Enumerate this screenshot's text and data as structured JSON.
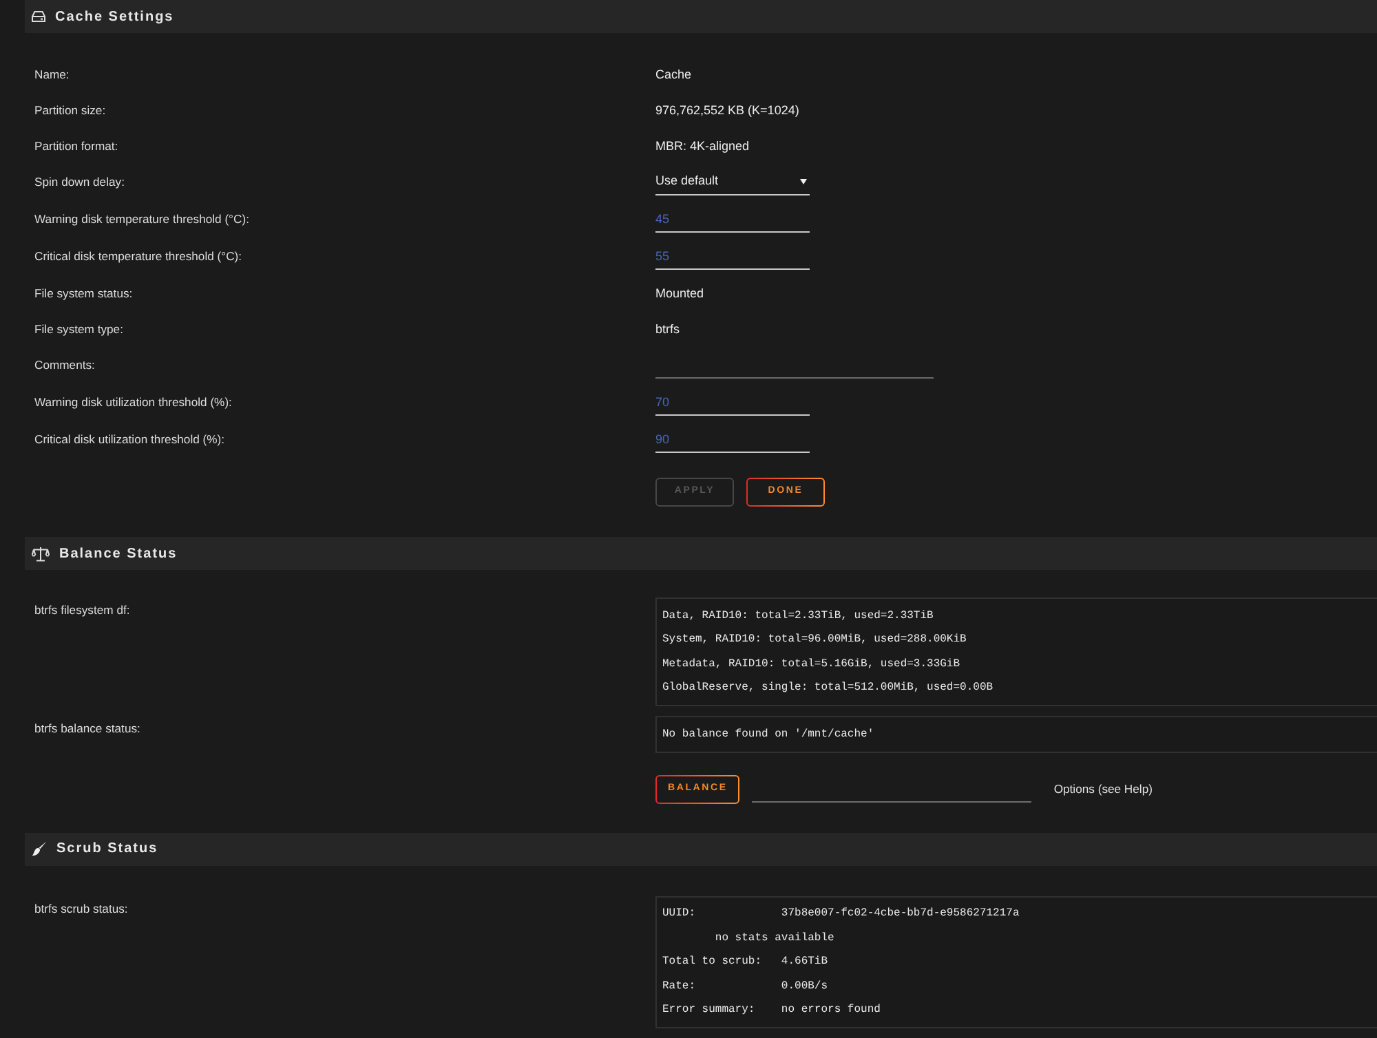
{
  "sections": [
    {
      "title": "Cache Settings",
      "fields": [
        {
          "label": "Name:",
          "kind": "text",
          "value": "Cache"
        },
        {
          "label": "Partition size:",
          "kind": "text",
          "value": "976,762,552 KB (K=1024)"
        },
        {
          "label": "Partition format:",
          "kind": "text",
          "value": "MBR: 4K-aligned"
        },
        {
          "label": "Spin down delay:",
          "kind": "select",
          "value": "Use default"
        },
        {
          "label": "Warning disk temperature threshold (°C):",
          "kind": "number",
          "value": "45"
        },
        {
          "label": "Critical disk temperature threshold (°C):",
          "kind": "number",
          "value": "55"
        },
        {
          "label": "File system status:",
          "kind": "text",
          "value": "Mounted"
        },
        {
          "label": "File system type:",
          "kind": "text",
          "value": "btrfs"
        },
        {
          "label": "Comments:",
          "kind": "textline"
        },
        {
          "label": "Warning disk utilization threshold (%):",
          "kind": "number",
          "value": "70"
        },
        {
          "label": "Critical disk utilization threshold (%):",
          "kind": "number",
          "value": "90"
        }
      ],
      "actions": [
        {
          "kind": "button",
          "label": "APPLY",
          "disabled": true
        },
        {
          "kind": "button",
          "label": "DONE",
          "disabled": false
        }
      ]
    },
    {
      "title": "Balance Status",
      "fields": [
        {
          "label": "btrfs filesystem df:",
          "kind": "output",
          "lines": [
            "Data, RAID10: total=2.33TiB, used=2.33TiB",
            "System, RAID10: total=96.00MiB, used=288.00KiB",
            "Metadata, RAID10: total=5.16GiB, used=3.33GiB",
            "GlobalReserve, single: total=512.00MiB, used=0.00B"
          ]
        },
        {
          "label": "btrfs balance status:",
          "kind": "output",
          "lines": [
            "No balance found on '/mnt/cache'"
          ]
        }
      ],
      "actions": [
        {
          "kind": "button",
          "label": "BALANCE",
          "disabled": false
        },
        {
          "kind": "field"
        },
        {
          "kind": "note",
          "text": "Options (see Help)"
        }
      ]
    },
    {
      "title": "Scrub Status",
      "fields": [
        {
          "label": "btrfs scrub status:",
          "kind": "output",
          "lines": [
            "UUID:             37b8e007-fc02-4cbe-bb7d-e9586271217a",
            "        no stats available",
            "Total to scrub:   4.66TiB",
            "Rate:             0.00B/s",
            "Error summary:    no errors found"
          ]
        }
      ]
    }
  ]
}
